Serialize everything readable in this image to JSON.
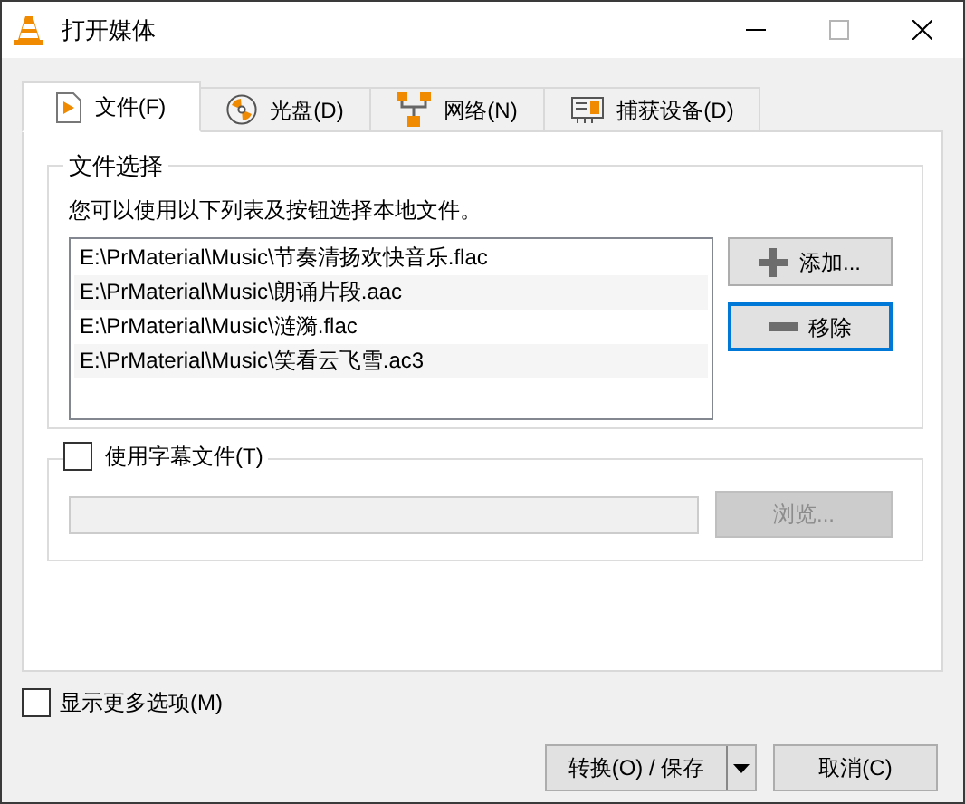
{
  "window": {
    "title": "打开媒体"
  },
  "tabs": [
    {
      "label": "文件(F)",
      "kind": "file",
      "selected": true
    },
    {
      "label": "光盘(D)",
      "kind": "disc",
      "selected": false
    },
    {
      "label": "网络(N)",
      "kind": "network",
      "selected": false
    },
    {
      "label": "捕获设备(D)",
      "kind": "capture",
      "selected": false
    }
  ],
  "file_group": {
    "title": "文件选择",
    "hint": "您可以使用以下列表及按钮选择本地文件。",
    "files": [
      {
        "path": "E:\\PrMaterial\\Music\\节奏清扬欢快音乐.flac"
      },
      {
        "path": "E:\\PrMaterial\\Music\\朗诵片段.aac"
      },
      {
        "path": "E:\\PrMaterial\\Music\\涟漪.flac"
      },
      {
        "path": "E:\\PrMaterial\\Music\\笑看云飞雪.ac3"
      }
    ],
    "buttons": [
      {
        "label": "添加...",
        "kind": "add",
        "focused": false
      },
      {
        "label": "移除",
        "kind": "remove",
        "focused": true
      }
    ]
  },
  "subtitle": {
    "label": "使用字幕文件(T)",
    "checked": false,
    "browse_button": {
      "label": "浏览...",
      "disabled": true
    }
  },
  "more_options": {
    "label": "显示更多选项(M)",
    "checked": false
  },
  "buttons": [
    {
      "label": "转换(O) / 保存",
      "kind": "split"
    },
    {
      "label": "取消(C)",
      "kind": "plain"
    }
  ]
}
